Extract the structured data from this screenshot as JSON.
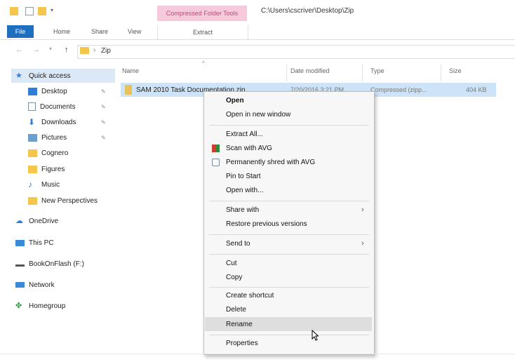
{
  "window": {
    "context_group": "Compressed Folder Tools",
    "path_title": "C:\\Users\\cscriver\\Desktop\\Zip"
  },
  "ribbon": {
    "tabs": [
      "File",
      "Home",
      "Share",
      "View"
    ],
    "context_tab": "Extract"
  },
  "address": {
    "separator": "›",
    "crumb": "Zip"
  },
  "sidebar": {
    "items": [
      {
        "label": "Quick access",
        "icon": "star-icon",
        "pinned": false
      },
      {
        "label": "Desktop",
        "icon": "desktop-icon",
        "pinned": true
      },
      {
        "label": "Documents",
        "icon": "documents-icon",
        "pinned": true
      },
      {
        "label": "Downloads",
        "icon": "download-icon",
        "pinned": true
      },
      {
        "label": "Pictures",
        "icon": "pictures-icon",
        "pinned": true
      },
      {
        "label": "Cognero",
        "icon": "folder-icon",
        "pinned": false
      },
      {
        "label": "Figures",
        "icon": "folder-icon",
        "pinned": false
      },
      {
        "label": "Music",
        "icon": "music-icon",
        "pinned": false
      },
      {
        "label": "New Perspectives",
        "icon": "folder-icon",
        "pinned": false
      },
      {
        "label": "OneDrive",
        "icon": "cloud-icon",
        "pinned": false
      },
      {
        "label": "This PC",
        "icon": "computer-icon",
        "pinned": false
      },
      {
        "label": "BookOnFlash (F:)",
        "icon": "drive-icon",
        "pinned": false
      },
      {
        "label": "Network",
        "icon": "network-icon",
        "pinned": false
      },
      {
        "label": "Homegroup",
        "icon": "homegroup-icon",
        "pinned": false
      }
    ]
  },
  "columns": {
    "name": "Name",
    "date": "Date modified",
    "type": "Type",
    "size": "Size"
  },
  "file": {
    "name": "SAM 2010 Task Documentation.zip",
    "date": "7/20/2016 3:21 PM",
    "type": "Compressed (zipp...",
    "size": "404 KB"
  },
  "context_menu": {
    "open": "Open",
    "open_new_window": "Open in new window",
    "extract_all": "Extract All...",
    "scan_avg": "Scan with AVG",
    "shred_avg": "Permanently shred with AVG",
    "pin_start": "Pin to Start",
    "open_with": "Open with...",
    "share_with": "Share with",
    "restore_versions": "Restore previous versions",
    "send_to": "Send to",
    "cut": "Cut",
    "copy": "Copy",
    "create_shortcut": "Create shortcut",
    "delete": "Delete",
    "rename": "Rename",
    "properties": "Properties",
    "chevron": "›"
  },
  "colors": {
    "accent": "#1e6fbf",
    "context_group": "#f6c9db",
    "selection": "#cde3f7"
  }
}
